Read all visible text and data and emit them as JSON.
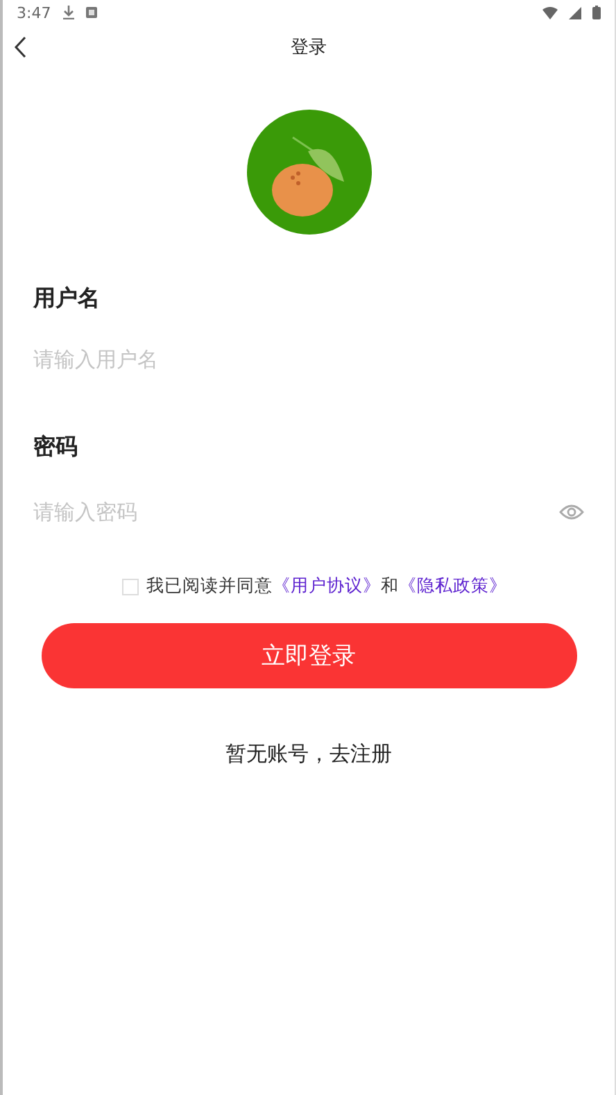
{
  "status_bar": {
    "time": "3:47"
  },
  "nav": {
    "title": "登录"
  },
  "username": {
    "label": "用户名",
    "placeholder": "请输入用户名"
  },
  "password": {
    "label": "密码",
    "placeholder": "请输入密码"
  },
  "agreement": {
    "checked": false,
    "text": "我已阅读并同意",
    "link_1": "《用户协议》",
    "joiner": "和",
    "link_2": "《隐私政策》"
  },
  "login_button": "立即登录",
  "register_link": "暂无账号，去注册"
}
